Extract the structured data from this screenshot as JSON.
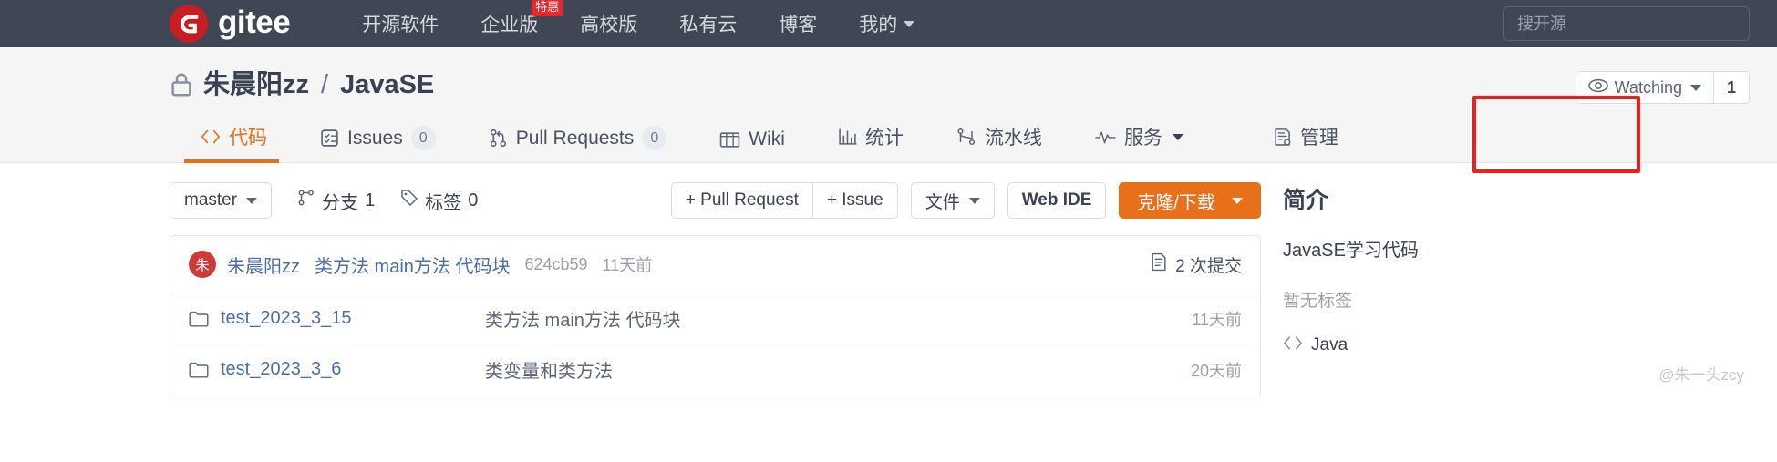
{
  "header": {
    "brand": "gitee",
    "nav": [
      {
        "label": "开源软件",
        "badge": null,
        "caret": false
      },
      {
        "label": "企业版",
        "badge": "特惠",
        "caret": false
      },
      {
        "label": "高校版",
        "badge": null,
        "caret": false
      },
      {
        "label": "私有云",
        "badge": null,
        "caret": false
      },
      {
        "label": "博客",
        "badge": null,
        "caret": false
      },
      {
        "label": "我的",
        "badge": null,
        "caret": true
      }
    ],
    "search_placeholder": "搜开源",
    "bg_color": "#3f4654",
    "brand_color": "#c71d23"
  },
  "repo": {
    "owner": "朱晨阳zz",
    "separator": "/",
    "name": "JavaSE",
    "visibility": "private",
    "watch_label": "Watching",
    "watch_count": "1"
  },
  "tabs": [
    {
      "label": "代码",
      "icon": "code-icon",
      "count": null,
      "active": true,
      "caret": false
    },
    {
      "label": "Issues",
      "icon": "issue-icon",
      "count": "0",
      "active": false,
      "caret": false
    },
    {
      "label": "Pull Requests",
      "icon": "pull-request-icon",
      "count": "0",
      "active": false,
      "caret": false
    },
    {
      "label": "Wiki",
      "icon": "wiki-icon",
      "count": null,
      "active": false,
      "caret": false
    },
    {
      "label": "统计",
      "icon": "chart-icon",
      "count": null,
      "active": false,
      "caret": false
    },
    {
      "label": "流水线",
      "icon": "pipeline-icon",
      "count": null,
      "active": false,
      "caret": false
    },
    {
      "label": "服务",
      "icon": "service-icon",
      "count": null,
      "active": false,
      "caret": true
    },
    {
      "label": "管理",
      "icon": "manage-icon",
      "count": null,
      "active": false,
      "caret": false
    }
  ],
  "annotation": {
    "color": "#f01d1d",
    "target": "管理"
  },
  "toolbar": {
    "branch": "master",
    "branches_label": "分支",
    "branches_count": "1",
    "tags_label": "标签",
    "tags_count": "0",
    "pull_request_label": "+ Pull Request",
    "issue_label": "+ Issue",
    "files_label": "文件",
    "web_ide_label": "Web IDE",
    "clone_label": "克隆/下载",
    "clone_color": "#e8701a"
  },
  "commit": {
    "avatar_initial": "朱",
    "author": "朱晨阳zz",
    "message": "类方法 main方法 代码块",
    "sha": "624cb59",
    "time": "11天前",
    "commits_count_label": "2 次提交"
  },
  "files": [
    {
      "name": "test_2023_3_15",
      "type": "folder",
      "message": "类方法 main方法 代码块",
      "time": "11天前"
    },
    {
      "name": "test_2023_3_6",
      "type": "folder",
      "message": "类变量和类方法",
      "time": "20天前"
    }
  ],
  "sidebar": {
    "title": "简介",
    "description": "JavaSE学习代码",
    "tags_empty": "暂无标签",
    "language": "Java"
  },
  "watermark": "@朱一头zcy"
}
